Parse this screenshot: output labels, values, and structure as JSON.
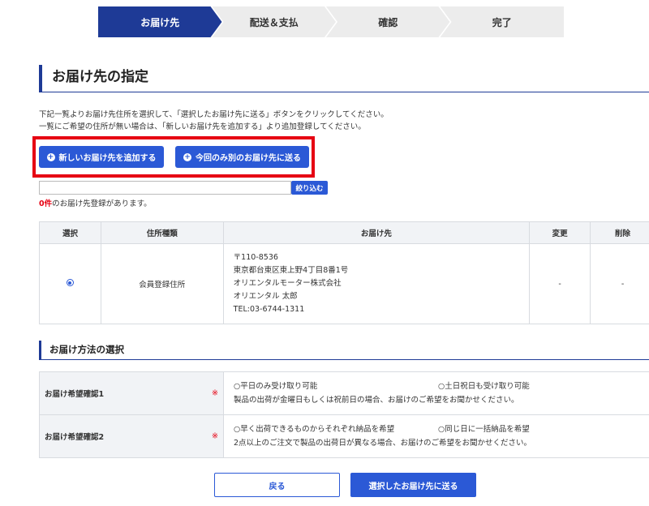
{
  "steps": [
    {
      "label": "お届け先",
      "active": true
    },
    {
      "label": "配送＆支払",
      "active": false
    },
    {
      "label": "確認",
      "active": false
    },
    {
      "label": "完了",
      "active": false
    }
  ],
  "page_title": "お届け先の指定",
  "description": {
    "line1": "下記一覧よりお届け先住所を選択して、「選択したお届け先に送る」ボタンをクリックしてください。",
    "line2": "一覧にご希望の住所が無い場合は、「新しいお届け先を追加する」より追加登録してください。"
  },
  "buttons": {
    "add_new": "新しいお届け先を追加する",
    "send_other": "今回のみ別のお届け先に送る",
    "filter": "絞り込む",
    "back": "戻る",
    "send_selected": "選択したお届け先に送る"
  },
  "search": {
    "value": "",
    "placeholder": ""
  },
  "count": {
    "number": "0件",
    "suffix": "のお届け先登録があります。"
  },
  "address_table": {
    "headers": {
      "select": "選択",
      "type": "住所種類",
      "address": "お届け先",
      "edit": "変更",
      "delete": "削除"
    },
    "rows": [
      {
        "selected": true,
        "type": "会員登録住所",
        "postal": "〒110-8536",
        "street": "東京都台東区東上野4丁目8番1号",
        "company": "オリエンタルモーター株式会社",
        "name": "オリエンタル 太郎",
        "tel": "TEL:03-6744-1311",
        "edit": "-",
        "delete": "-"
      }
    ]
  },
  "method_section": {
    "title": "お届け方法の選択",
    "rows": [
      {
        "label": "お届け希望確認1",
        "required_mark": "※",
        "option1": "○平日のみ受け取り可能",
        "option2": "○土日祝日も受け取り可能",
        "note": "製品の出荷が金曜日もしくは祝前日の場合、お届けのご希望をお聞かせください。"
      },
      {
        "label": "お届け希望確認2",
        "required_mark": "※",
        "option1": "○早く出荷できるものからそれぞれ納品を希望",
        "option2": "○同じ日に一括納品を希望",
        "note": "2点以上のご注文で製品の出荷日が異なる場合、お届けのご希望をお聞かせください。"
      }
    ]
  },
  "colors": {
    "accent": "#1e3a96",
    "button": "#2b59d6",
    "highlight": "#e60012"
  },
  "icons": {
    "add": "plus-circle-icon",
    "radio": "radio-selected-icon"
  }
}
